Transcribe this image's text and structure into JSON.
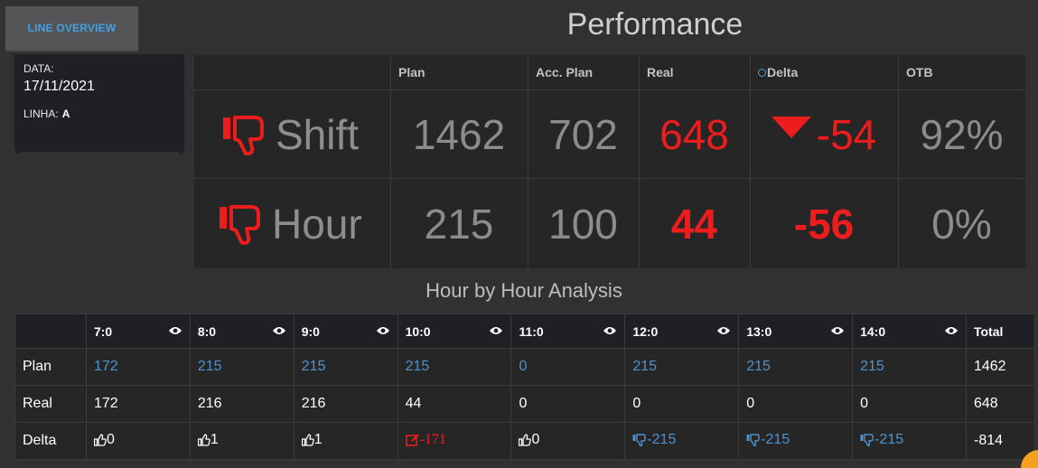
{
  "tab": {
    "label": "LINE OVERVIEW"
  },
  "info": {
    "data_label": "DATA:",
    "date": "17/11/2021",
    "linha_label": "LINHA:",
    "linha_value": "A"
  },
  "performance": {
    "title": "Performance",
    "headers": [
      "Plan",
      "Acc. Plan",
      "Real",
      "Delta",
      "OTB"
    ],
    "rows": [
      {
        "label": "Shift",
        "plan": "1462",
        "acc_plan": "702",
        "real": "648",
        "delta": "-54",
        "otb": "92%"
      },
      {
        "label": "Hour",
        "plan": "215",
        "acc_plan": "100",
        "real": "44",
        "delta": "-56",
        "otb": "0%"
      }
    ]
  },
  "hourly": {
    "title": "Hour by Hour Analysis",
    "hours": [
      "7:0",
      "8:0",
      "9:0",
      "10:0",
      "11:0",
      "12:0",
      "13:0",
      "14:0"
    ],
    "total_label": "Total",
    "plan_label": "Plan",
    "real_label": "Real",
    "delta_label": "Delta",
    "plan": [
      "172",
      "215",
      "215",
      "215",
      "0",
      "215",
      "215",
      "215"
    ],
    "plan_total": "1462",
    "real": [
      "172",
      "216",
      "216",
      "44",
      "0",
      "0",
      "0",
      "0"
    ],
    "real_total": "648",
    "delta": [
      "0",
      "1",
      "1",
      "-171",
      "0",
      "-215",
      "-215",
      "-215"
    ],
    "delta_icons": [
      "thumbs-up-icon",
      "thumbs-up-icon",
      "thumbs-up-icon",
      "edit-icon",
      "thumbs-up-icon",
      "thumbs-down-icon",
      "thumbs-down-icon",
      "thumbs-down-icon"
    ],
    "delta_total": "-814"
  },
  "colors": {
    "accent_blue": "#3fa0e6",
    "alert_red": "#ee1d1d",
    "plan_blue": "#4f93cf",
    "orange": "#f5a01e"
  }
}
